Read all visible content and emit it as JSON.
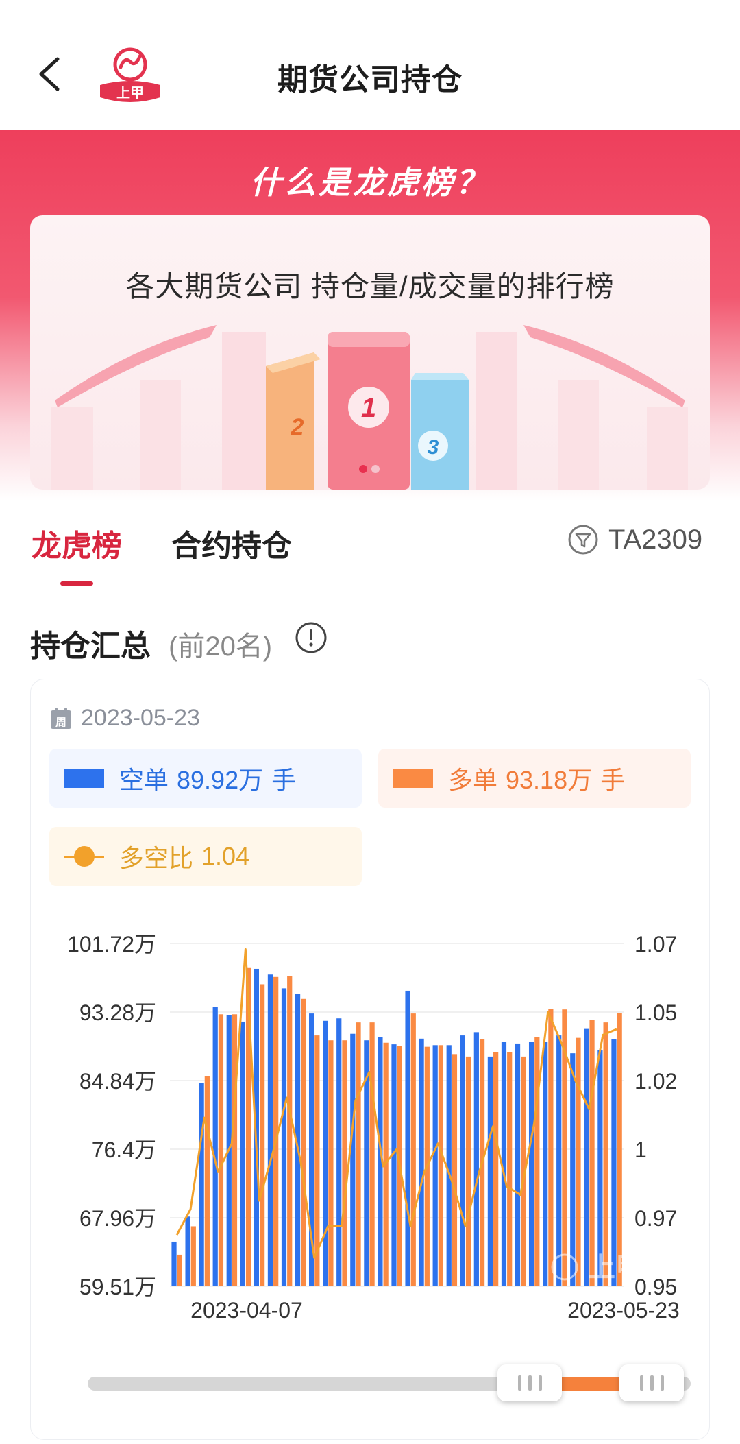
{
  "header": {
    "title": "期货公司持仓",
    "logo_text": "上甲"
  },
  "banner": {
    "question": "什么是龙虎榜？",
    "description": "各大期货公司 持仓量/成交量的排行榜",
    "ranks": [
      "2",
      "1",
      "3"
    ],
    "carousel_index": 1,
    "carousel_count": 2
  },
  "tabs": {
    "items": [
      "龙虎榜",
      "合约持仓"
    ],
    "active": "龙虎榜"
  },
  "contract": {
    "code": "TA2309"
  },
  "section": {
    "title": "持仓汇总",
    "subtitle": "(前20名)"
  },
  "summary": {
    "date": "2023-05-23",
    "short_label": "空单",
    "short_value": "89.92万",
    "short_unit": "手",
    "long_label": "多单",
    "long_value": "93.18万",
    "long_unit": "手",
    "ratio_label": "多空比",
    "ratio_value": "1.04"
  },
  "colors": {
    "short": "#2d72ed",
    "long": "#fa8a43",
    "ratio": "#f2a12b",
    "accent": "#d8263f"
  },
  "chart_data": {
    "type": "bar",
    "x_start_label": "2023-04-07",
    "x_end_label": "2023-05-23",
    "left_ticks": [
      "101.72万",
      "93.28万",
      "84.84万",
      "76.4万",
      "67.96万",
      "59.51万"
    ],
    "right_ticks": [
      "1.07",
      "1.05",
      "1.02",
      "1",
      "0.97",
      "0.95"
    ],
    "left_range": [
      59.51,
      101.72
    ],
    "right_range": [
      0.95,
      1.07
    ],
    "watermark": "上甲",
    "series": [
      {
        "name": "空单",
        "values": [
          65,
          68.1,
          84.5,
          93.9,
          92.9,
          92.1,
          98.6,
          97.9,
          96.2,
          95.5,
          93.1,
          92.2,
          92.5,
          90.6,
          89.8,
          90.2,
          89.3,
          95.9,
          90.0,
          89.2,
          89.2,
          90.4,
          90.8,
          87.8,
          89.6,
          89.4,
          89.6,
          89.6,
          90.4,
          88.2,
          91.2,
          88.6,
          89.9
        ]
      },
      {
        "name": "多单",
        "values": [
          63.4,
          66.9,
          85.4,
          93.0,
          93.0,
          98.7,
          96.7,
          97.6,
          97.7,
          94.9,
          90.4,
          89.8,
          89.8,
          92.0,
          92.0,
          89.5,
          89.1,
          93.1,
          89.0,
          89.2,
          88.1,
          87.8,
          89.9,
          88.3,
          88.3,
          87.8,
          90.2,
          93.7,
          93.6,
          90.1,
          92.3,
          92.0,
          93.18
        ]
      },
      {
        "name": "多空比",
        "values": [
          0.968,
          0.977,
          1.009,
          0.99,
          1.0,
          1.068,
          0.98,
          0.997,
          1.016,
          0.994,
          0.96,
          0.971,
          0.971,
          1.015,
          1.025,
          0.992,
          0.998,
          0.971,
          0.99,
          1.0,
          0.987,
          0.971,
          0.99,
          1.006,
          0.985,
          0.982,
          1.007,
          1.046,
          1.035,
          1.022,
          1.012,
          1.038,
          1.04
        ]
      }
    ]
  }
}
